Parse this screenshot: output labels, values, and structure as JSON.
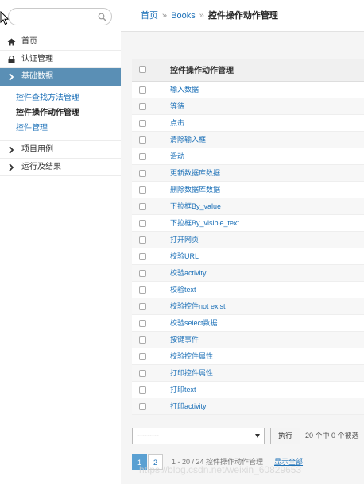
{
  "sidebar": {
    "search": {
      "placeholder": ""
    },
    "items": [
      {
        "label": "首页",
        "icon": "home-icon"
      },
      {
        "label": "认证管理",
        "icon": "lock-icon"
      },
      {
        "label": "基础数据",
        "icon": "chevron-right-icon",
        "active": true
      },
      {
        "label": "项目用例",
        "icon": "chevron-right-icon"
      },
      {
        "label": "运行及结果",
        "icon": "chevron-right-icon"
      }
    ],
    "sub_items": [
      {
        "label": "控件查找方法管理"
      },
      {
        "label": "控件操作动作管理",
        "current": true
      },
      {
        "label": "控件管理"
      }
    ]
  },
  "breadcrumb": {
    "home": "首页",
    "books": "Books",
    "separator": "»",
    "current": "控件操作动作管理"
  },
  "table": {
    "header": "控件操作动作管理",
    "rows": [
      "输入数据",
      "等待",
      "点击",
      "清除输入框",
      "滑动",
      "更新数据库数据",
      "删除数据库数据",
      "下拉框By_value",
      "下拉框By_visible_text",
      "打开网页",
      "校验URL",
      "校验activity",
      "校验text",
      "校验控件not exist",
      "校验select数据",
      "按键事件",
      "校验控件属性",
      "打印控件属性",
      "打印text",
      "打印activity"
    ]
  },
  "actions": {
    "select_value": "---------",
    "execute_label": "执行",
    "selection_count": "20 个中 0 个被选"
  },
  "pager": {
    "pages": [
      "1",
      "2"
    ],
    "current_page": "1",
    "info": "1 - 20 / 24 控件操作动作管理",
    "show_all": "显示全部"
  },
  "watermark": "https://blog.csdn.net/weixin_60829653",
  "colors": {
    "accent": "#5a8fb5",
    "link": "#1d71b8",
    "page_active": "#5aa0d2"
  }
}
